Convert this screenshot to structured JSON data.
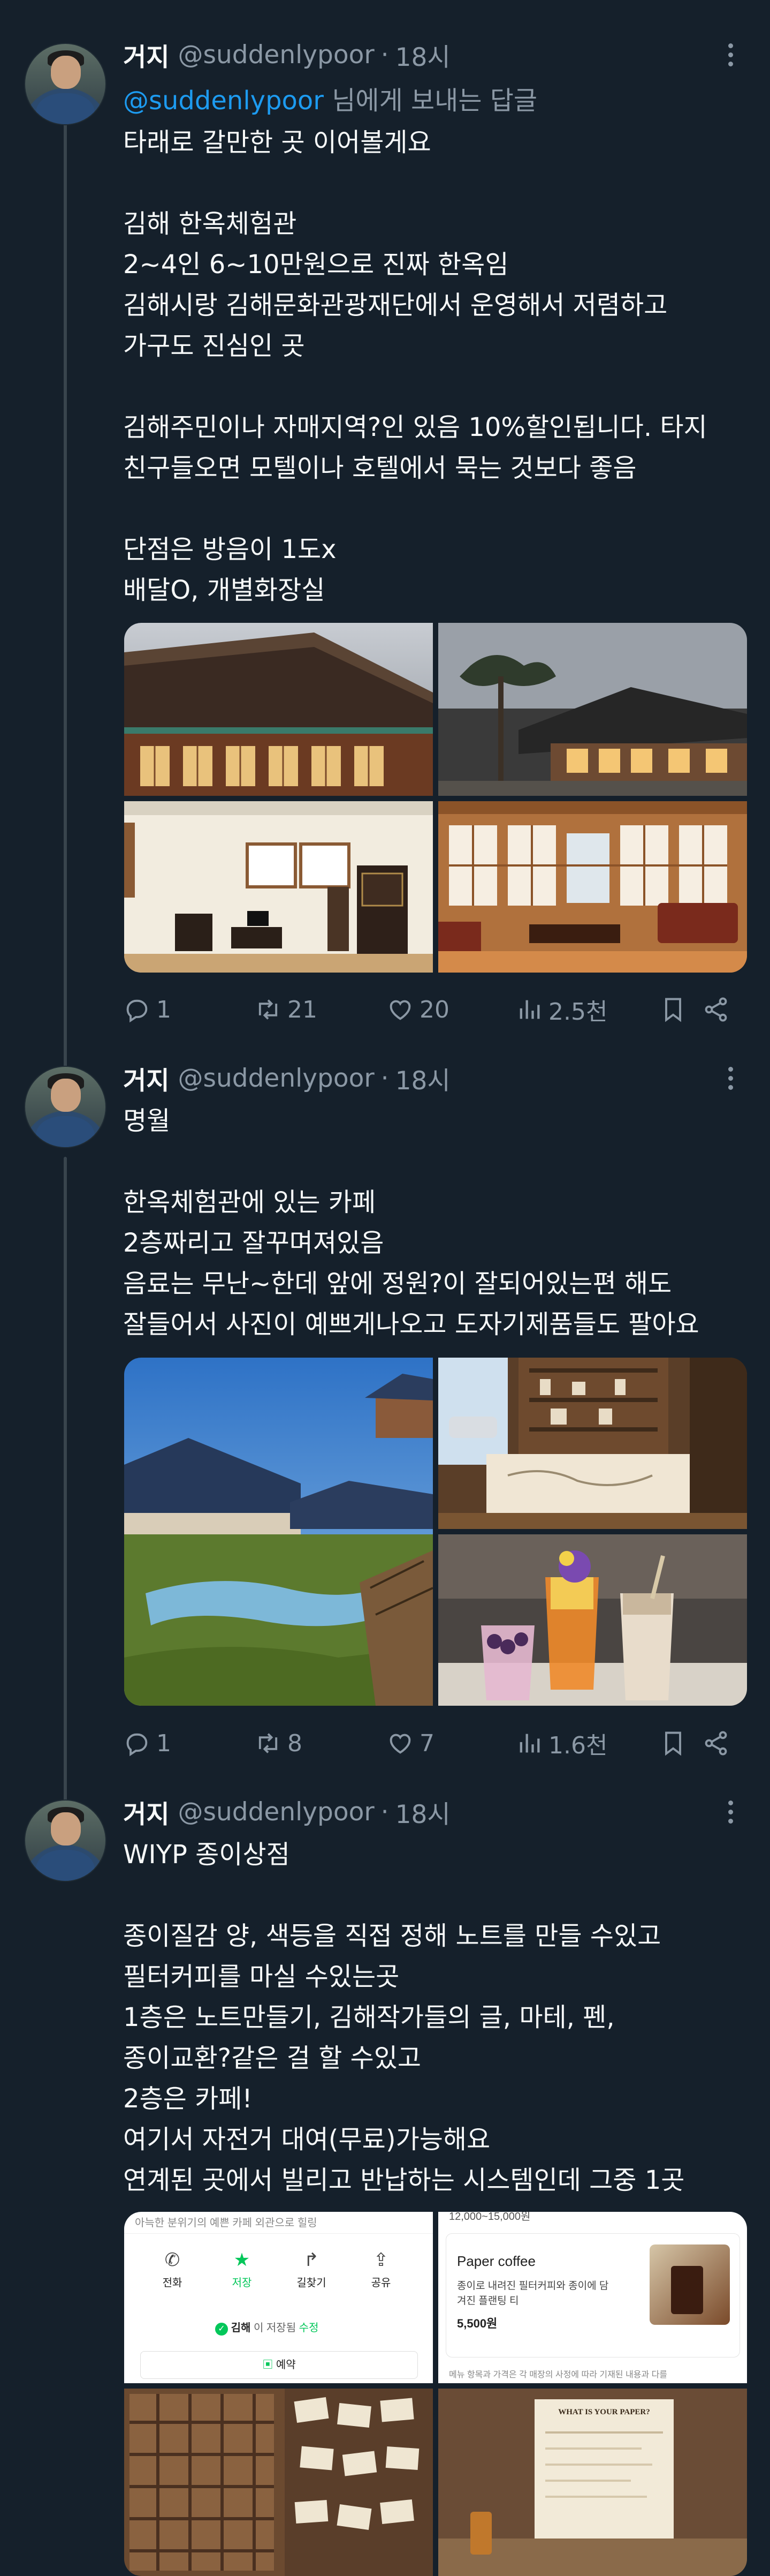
{
  "tweets": [
    {
      "name": "거지",
      "handle": "@suddenlypoor",
      "sep": "·",
      "time": "18시",
      "reply_mention": "@suddenlypoor",
      "reply_suffix": " 님에게 보내는 답글",
      "lines": [
        "타래로 갈만한 곳 이어볼게요",
        "",
        "김해 한옥체험관",
        "2~4인 6~10만원으로 진짜 한옥임",
        "김해시랑 김해문화관광재단에서 운영해서 저렴하고",
        "가구도 진심인 곳",
        "",
        "김해주민이나 자매지역?인 있음 10%할인됩니다. 타지",
        "친구들오면 모텔이나 호텔에서 묵는 것보다 좋음",
        "",
        "단점은 방음이 1도x",
        "배달O, 개별화장실"
      ],
      "stats": {
        "replies": "1",
        "retweets": "21",
        "likes": "20",
        "views": "2.5천"
      }
    },
    {
      "name": "거지",
      "handle": "@suddenlypoor",
      "sep": "·",
      "time": "18시",
      "lines": [
        "명월",
        "",
        "한옥체험관에 있는 카페",
        "2층짜리고 잘꾸며져있음",
        "음료는 무난~한데 앞에 정원?이 잘되어있는편 해도",
        "잘들어서 사진이 예쁘게나오고 도자기제품들도 팔아요"
      ],
      "stats": {
        "replies": "1",
        "retweets": "8",
        "likes": "7",
        "views": "1.6천"
      }
    },
    {
      "name": "거지",
      "handle": "@suddenlypoor",
      "sep": "·",
      "time": "18시",
      "lines": [
        "WIYP 종이상점",
        "",
        "종이질감 양, 색등을 직접 정해 노트를 만들 수있고",
        "필터커피를 마실 수있는곳",
        "1층은 노트만들기, 김해작가들의 글, 마테, 펜,",
        "종이교환?같은 걸 할 수있고",
        "2층은 카페!",
        "여기서 자전거 대여(무료)가능해요",
        "연계된 곳에서 빌리고 반납하는 시스템인데 그중 1곳"
      ],
      "shot1": {
        "top_text": "아늑한 분위기의 예쁜 카페 외관으로 힐링",
        "buttons": [
          "전화",
          "저장",
          "길찾기",
          "공유"
        ],
        "place": "김해",
        "saved": "이 저장됨",
        "edit": "수정",
        "reserve": "예약"
      },
      "shot2": {
        "price_range": "12,000~15,000원",
        "item_title": "Paper coffee",
        "item_desc1": "종이로 내려진 필터커피와 종이에 담",
        "item_desc2": "겨진 플랜팅 티",
        "item_price": "5,500원",
        "footer": "메뉴 항목과 가격은 각 매장의 사정에 따라 기재된 내용과 다를"
      },
      "shot4": {
        "board_title": "WHAT IS YOUR PAPER?"
      }
    }
  ],
  "icons": [
    "reply-icon",
    "retweet-icon",
    "like-icon",
    "views-icon",
    "bookmark-icon",
    "share-icon",
    "more-icon"
  ],
  "colors": {
    "background": "#15202b",
    "text": "#f7f9f9",
    "muted": "#8b98a5",
    "link": "#1d9bf0",
    "thread_line": "#38444d",
    "naver_green": "#03c75a"
  }
}
